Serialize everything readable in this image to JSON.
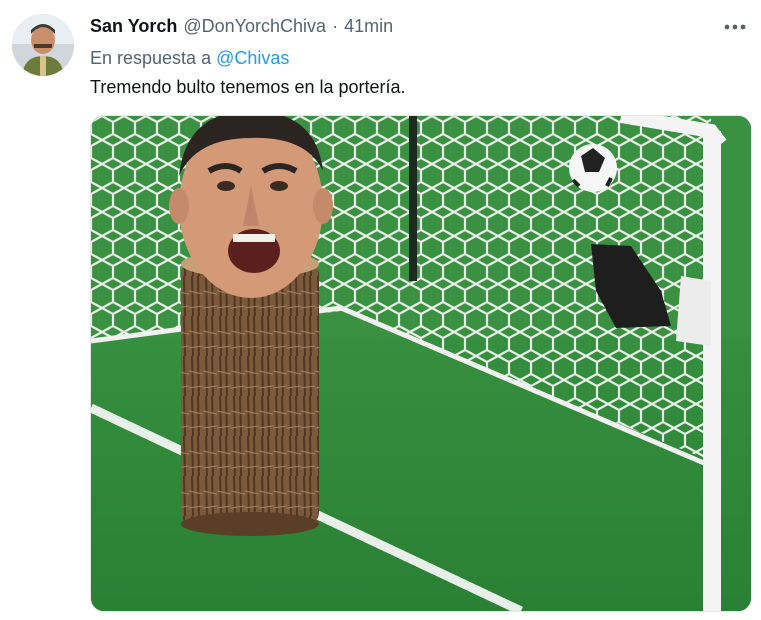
{
  "tweet": {
    "display_name": "San Yorch",
    "handle": "@DonYorchChiva",
    "separator": "·",
    "time": "41min",
    "reply_prefix": "En respuesta a",
    "reply_mention": "@Chivas",
    "text": "Tremendo bulto tenemos en la portería.",
    "more_icon": "more-dots-icon"
  },
  "media": {
    "description_icon": "meme-image",
    "colors": {
      "pitch": "#2f8f3c",
      "net": "#e6eee6",
      "post": "#f2f2f2",
      "trunk": "#7a5a3a"
    }
  }
}
